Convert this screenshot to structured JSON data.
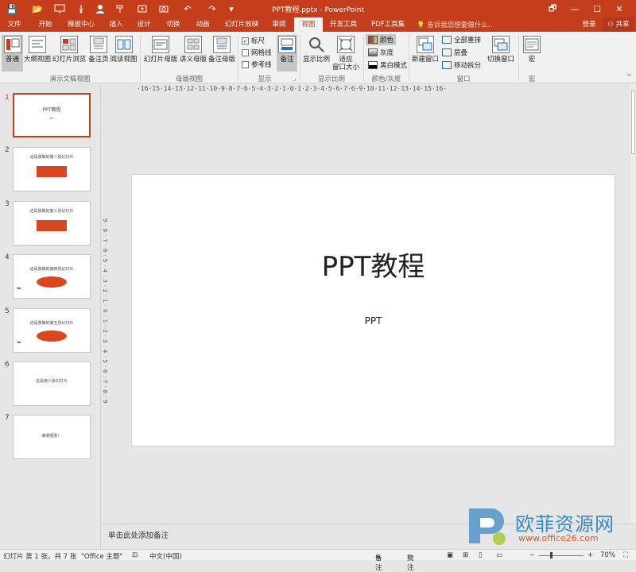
{
  "window": {
    "title": "PPT教程.pptx - PowerPoint"
  },
  "quick_access": {
    "save": "💾",
    "open": "📂",
    "share": "↪",
    "undo": "↶",
    "redo": "↷",
    "customize": "▾"
  },
  "window_controls": {
    "restore": "🗗",
    "minimize": "—",
    "maximize": "☐",
    "close": "✕"
  },
  "tabs": [
    "文件",
    "开始",
    "模板中心",
    "插入",
    "设计",
    "切换",
    "动画",
    "幻灯片放映",
    "审阅",
    "视图",
    "开发工具",
    "PDF工具集"
  ],
  "active_tab": "视图",
  "tell_me": "告诉我您想要做什么...",
  "account": {
    "login": "登录",
    "share": "共享"
  },
  "ribbon": {
    "presentation_views": {
      "label": "演示文稿视图",
      "buttons": [
        "普通",
        "大纲视图",
        "幻灯片浏览",
        "备注页",
        "阅读视图"
      ]
    },
    "master_views": {
      "label": "母版视图",
      "buttons": [
        "幻灯片母版",
        "讲义母版",
        "备注母版"
      ]
    },
    "show": {
      "label": "显示",
      "checks": [
        {
          "label": "标尺",
          "checked": true
        },
        {
          "label": "网格线",
          "checked": false
        },
        {
          "label": "参考线",
          "checked": false
        }
      ],
      "notes": "备注"
    },
    "zoom": {
      "label": "显示比例",
      "buttons": [
        "显示比例",
        "适应\n窗口大小"
      ]
    },
    "color": {
      "label": "颜色/灰度",
      "items": [
        "颜色",
        "灰度",
        "黑白模式"
      ]
    },
    "window": {
      "label": "窗口",
      "new": "新建窗口",
      "items": [
        "全部重排",
        "层叠",
        "移动拆分"
      ],
      "switch": "切换窗口"
    },
    "macro": {
      "label": "宏",
      "button": "宏"
    }
  },
  "slides": [
    {
      "n": "1",
      "text": "PPT教程",
      "sub": "PPT"
    },
    {
      "n": "2",
      "text": "这是我做的第二张幻灯片"
    },
    {
      "n": "3",
      "text": "这是我做的第三张幻灯片"
    },
    {
      "n": "4",
      "text": "这是我做的第四张幻灯片"
    },
    {
      "n": "5",
      "text": "这是我做的第五张幻灯片"
    },
    {
      "n": "6",
      "text": "这是第六张幻灯片"
    },
    {
      "n": "7",
      "text": "谢谢观看！"
    }
  ],
  "ruler": {
    "h": "·16·15·14·13·12·11·10·9·8·7·6·5·4·3·2·1·0·1·2·3·4·5·6·7·6·9·10·11·12·13·14·15·16·",
    "v": "9·8·7·6·5·4·3·2·1·0·1·2·3·4·5·6·7·8·9"
  },
  "current_slide": {
    "title": "PPT教程",
    "subtitle": "PPT"
  },
  "notes_placeholder": "单击此处添加备注",
  "status": {
    "slide": "幻灯片 第 1 张，共 7 张",
    "theme": "\"Office 主题\"",
    "lang": "中文(中国)",
    "notes": "备注",
    "comments": "批注",
    "zoom": "70%"
  },
  "watermark": {
    "text": "欧菲资源网",
    "url": "www.office26.com"
  },
  "colors": {
    "accent": "#c43e1c",
    "ribbon": "#f1f1f1",
    "bg": "#e6e6e6"
  }
}
